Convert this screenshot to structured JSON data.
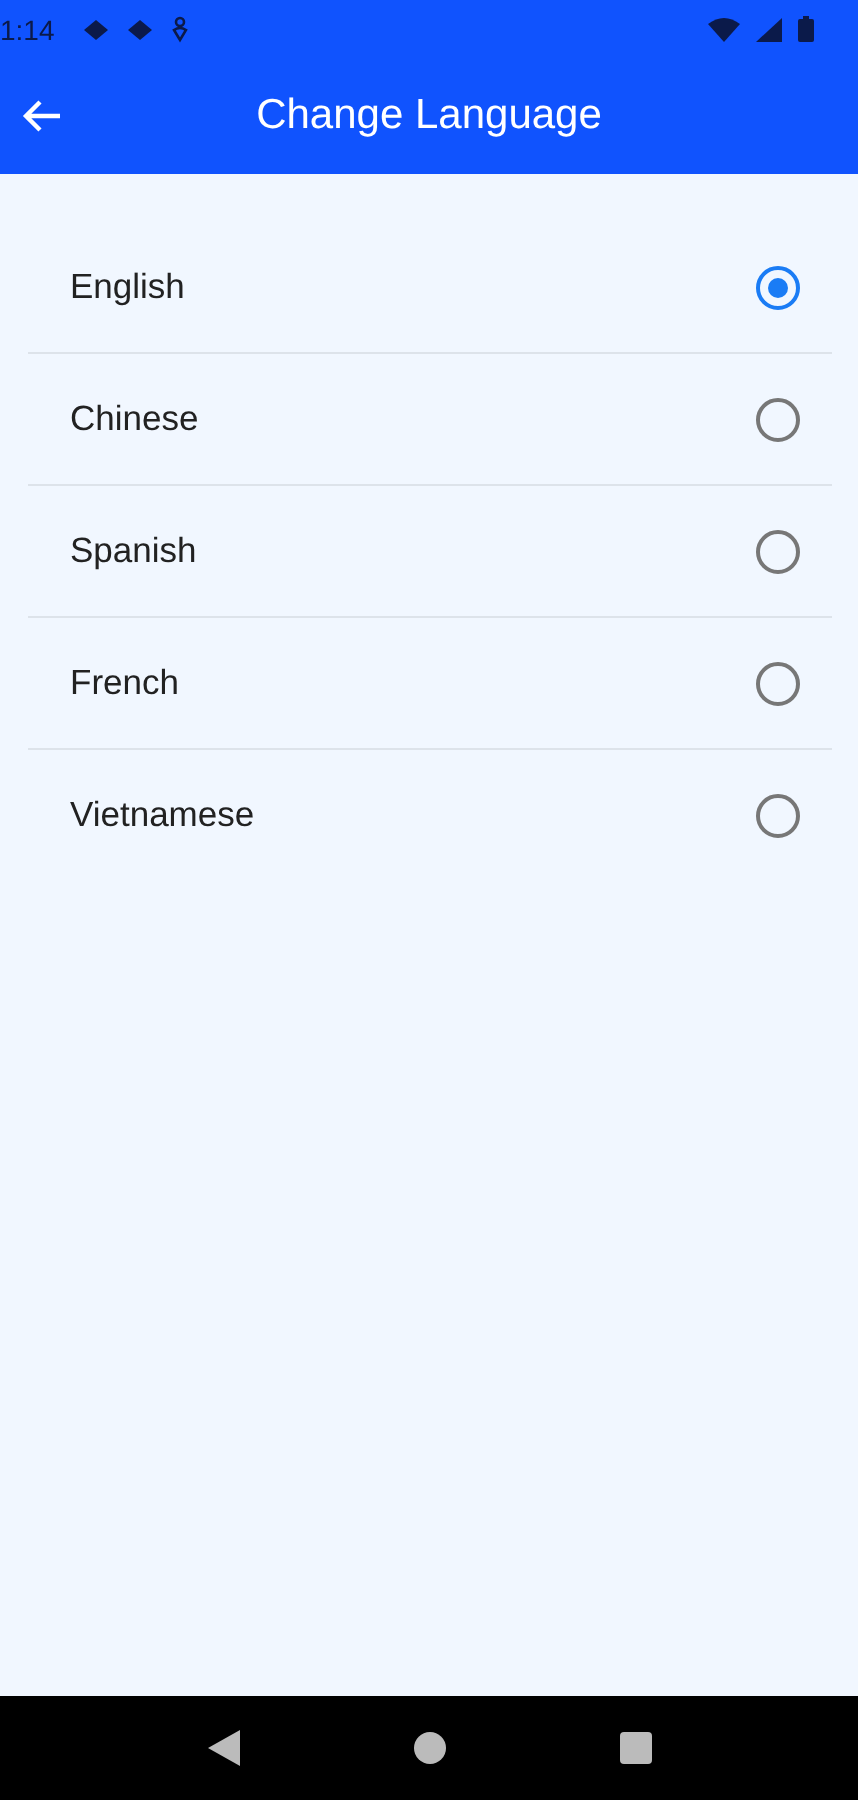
{
  "status_bar": {
    "time": "1:14"
  },
  "app_bar": {
    "title": "Change Language"
  },
  "languages": [
    {
      "label": "English",
      "selected": true
    },
    {
      "label": "Chinese",
      "selected": false
    },
    {
      "label": "Spanish",
      "selected": false
    },
    {
      "label": "French",
      "selected": false
    },
    {
      "label": "Vietnamese",
      "selected": false
    }
  ]
}
